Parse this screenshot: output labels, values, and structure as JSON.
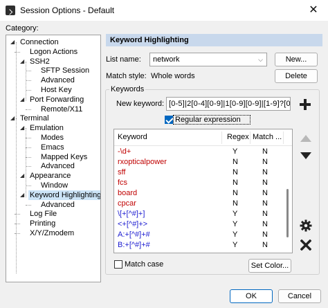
{
  "window": {
    "title": "Session Options - Default",
    "close_glyph": "✕",
    "icon": "app-icon"
  },
  "category_label": "Category:",
  "tree": [
    {
      "label": "Connection",
      "level": 0,
      "expanded": true
    },
    {
      "label": "Logon Actions",
      "level": 1
    },
    {
      "label": "SSH2",
      "level": 1,
      "expanded": true
    },
    {
      "label": "SFTP Session",
      "level": 2
    },
    {
      "label": "Advanced",
      "level": 2
    },
    {
      "label": "Host Key",
      "level": 2
    },
    {
      "label": "Port Forwarding",
      "level": 1,
      "expanded": true
    },
    {
      "label": "Remote/X11",
      "level": 2
    },
    {
      "label": "Terminal",
      "level": 0,
      "expanded": true
    },
    {
      "label": "Emulation",
      "level": 1,
      "expanded": true
    },
    {
      "label": "Modes",
      "level": 2
    },
    {
      "label": "Emacs",
      "level": 2
    },
    {
      "label": "Mapped Keys",
      "level": 2
    },
    {
      "label": "Advanced",
      "level": 2
    },
    {
      "label": "Appearance",
      "level": 1,
      "expanded": true
    },
    {
      "label": "Window",
      "level": 2
    },
    {
      "label": "Keyword Highlighting",
      "level": 1,
      "expanded": true,
      "selected": true
    },
    {
      "label": "Advanced",
      "level": 2
    },
    {
      "label": "Log File",
      "level": 1
    },
    {
      "label": "Printing",
      "level": 1
    },
    {
      "label": "X/Y/Zmodem",
      "level": 1
    }
  ],
  "panel": {
    "title": "Keyword Highlighting",
    "list_name_label": "List name:",
    "list_name_value": "network",
    "new_button": "New...",
    "match_style_label": "Match style:",
    "match_style_value": "Whole words",
    "delete_button": "Delete",
    "keywords_group": "Keywords",
    "new_keyword_label": "New keyword:",
    "new_keyword_value": "[0-5]|2[0-4][0-9]|1[0-9][0-9]|[1-9]?[0-9])",
    "regex_checkbox": {
      "label": "Regular expression",
      "checked": true
    },
    "columns": {
      "keyword": "Keyword",
      "regex": "Regex",
      "match": "Match ..."
    },
    "rows": [
      {
        "keyword": "-\\d+",
        "regex": "Y",
        "match": "N",
        "color": "#c00000"
      },
      {
        "keyword": "rxopticalpower",
        "regex": "N",
        "match": "N",
        "color": "#c00000"
      },
      {
        "keyword": "sff",
        "regex": "N",
        "match": "N",
        "color": "#c00000"
      },
      {
        "keyword": "fcs",
        "regex": "N",
        "match": "N",
        "color": "#c00000"
      },
      {
        "keyword": "board",
        "regex": "N",
        "match": "N",
        "color": "#c00000"
      },
      {
        "keyword": "cpcar",
        "regex": "N",
        "match": "N",
        "color": "#c00000"
      },
      {
        "keyword": "\\[+[^#]+]",
        "regex": "Y",
        "match": "N",
        "color": "#1a1ad0"
      },
      {
        "keyword": "<+[^#]+>",
        "regex": "Y",
        "match": "N",
        "color": "#1a1ad0"
      },
      {
        "keyword": "A:+[^#]+#",
        "regex": "Y",
        "match": "N",
        "color": "#1a1ad0"
      },
      {
        "keyword": "B:+[^#]+#",
        "regex": "Y",
        "match": "N",
        "color": "#1a1ad0"
      }
    ],
    "match_case_checkbox": {
      "label": "Match case",
      "checked": false
    },
    "set_color_button": "Set Color..."
  },
  "footer": {
    "ok_button": "OK",
    "cancel_button": "Cancel"
  },
  "colors": {
    "header_bg": "#c8d8ec",
    "accent": "#0067c0",
    "selection": "#cce4f7"
  }
}
